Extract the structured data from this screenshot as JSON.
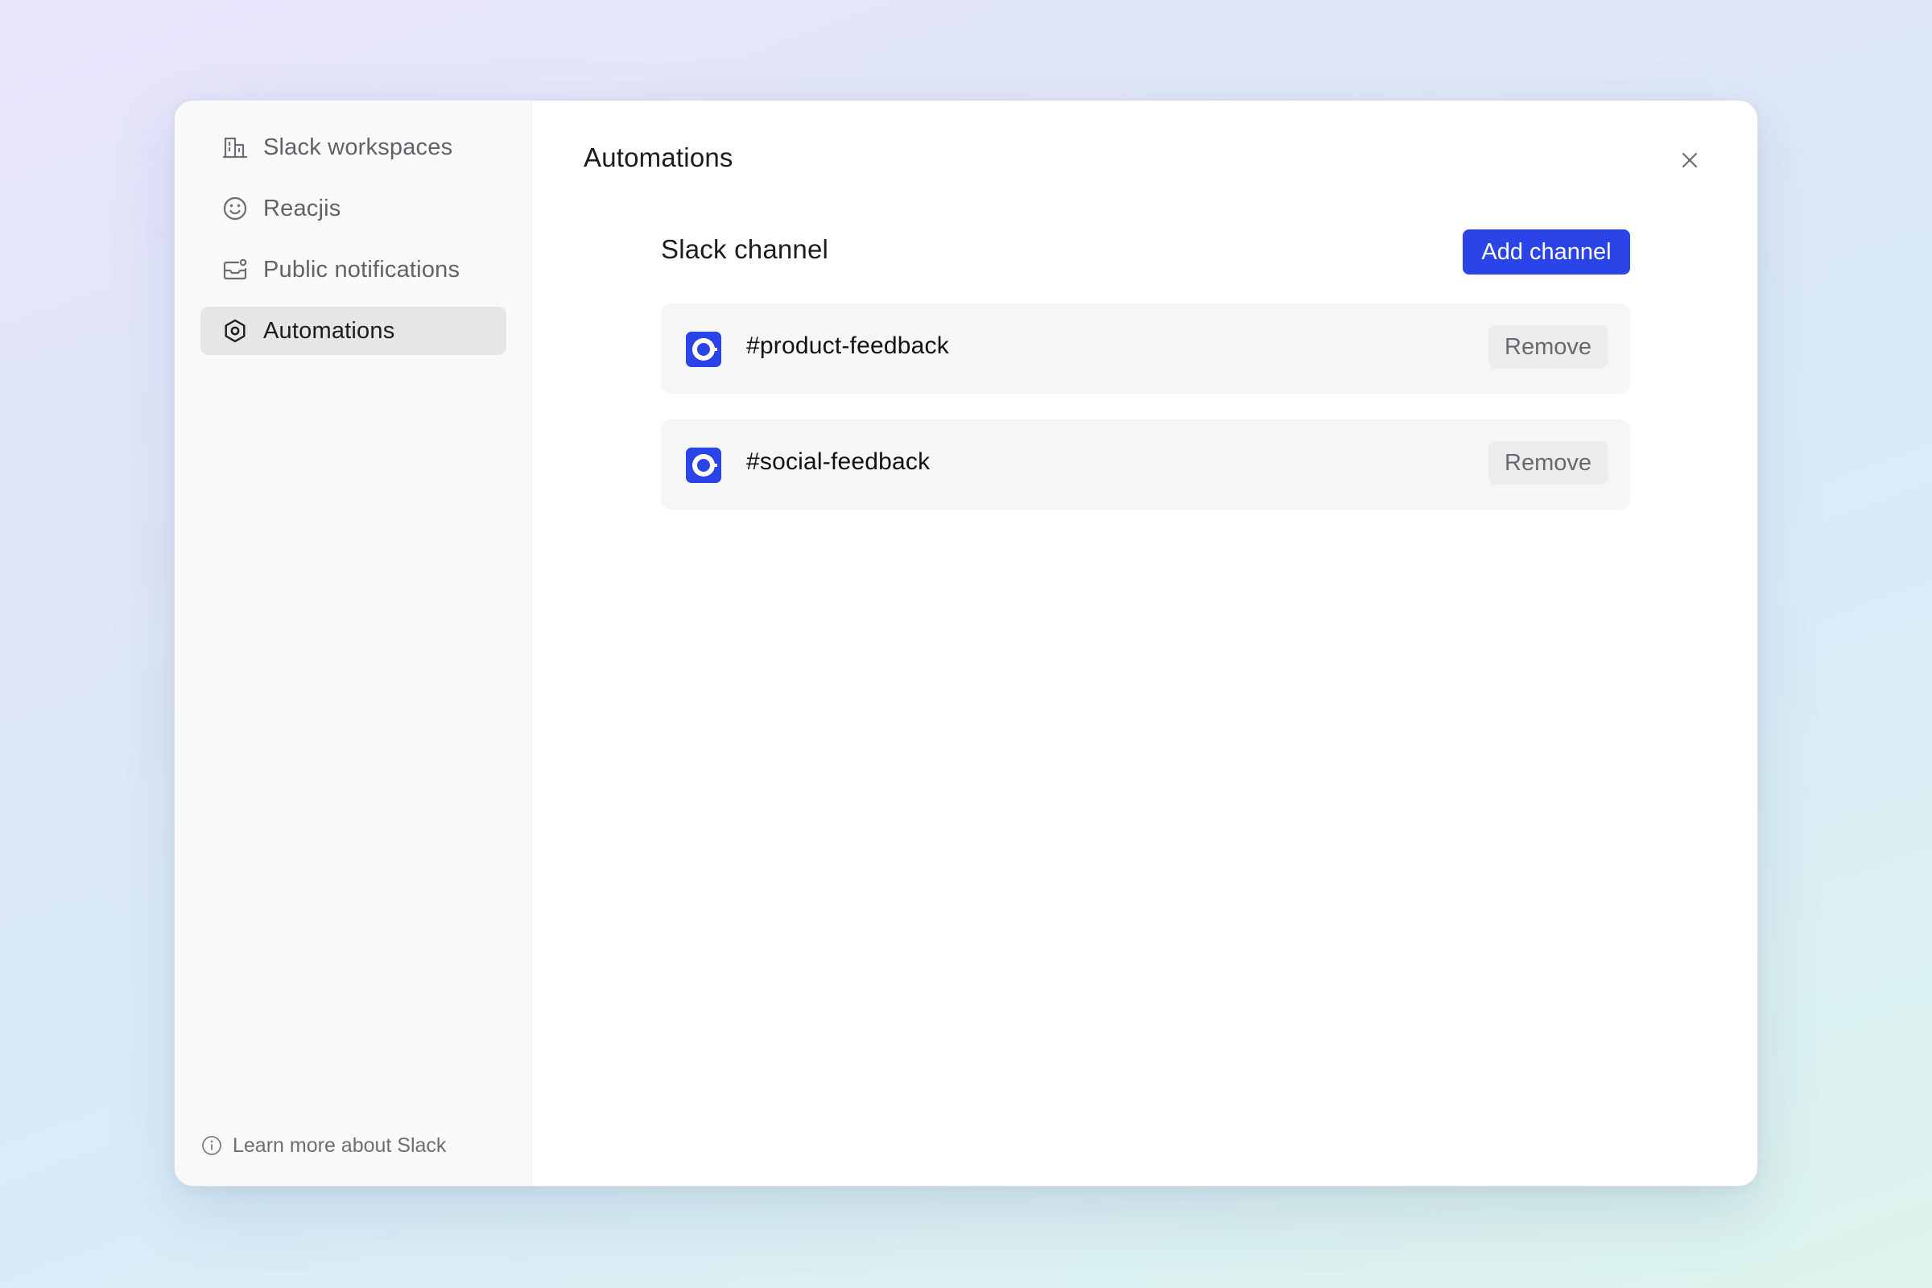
{
  "sidebar": {
    "items": [
      {
        "label": "Slack workspaces",
        "icon": "building-icon",
        "active": false
      },
      {
        "label": "Reacjis",
        "icon": "smiley-icon",
        "active": false
      },
      {
        "label": "Public notifications",
        "icon": "notification-inbox-icon",
        "active": false
      },
      {
        "label": "Automations",
        "icon": "hexagon-gear-icon",
        "active": true
      }
    ],
    "footer": {
      "label": "Learn more about Slack",
      "icon": "info-icon"
    }
  },
  "main": {
    "title": "Automations",
    "close_icon": "close-icon",
    "section": {
      "title": "Slack channel",
      "add_button_label": "Add channel",
      "channels": [
        {
          "name": "#product-feedback",
          "icon": "channel-logo-icon",
          "remove_label": "Remove"
        },
        {
          "name": "#social-feedback",
          "icon": "channel-logo-icon",
          "remove_label": "Remove"
        }
      ]
    }
  },
  "colors": {
    "accent": "#2b44e7",
    "active_nav_bg": "#e6e6e6",
    "row_bg": "#f6f6f6",
    "remove_bg": "#ececec"
  }
}
